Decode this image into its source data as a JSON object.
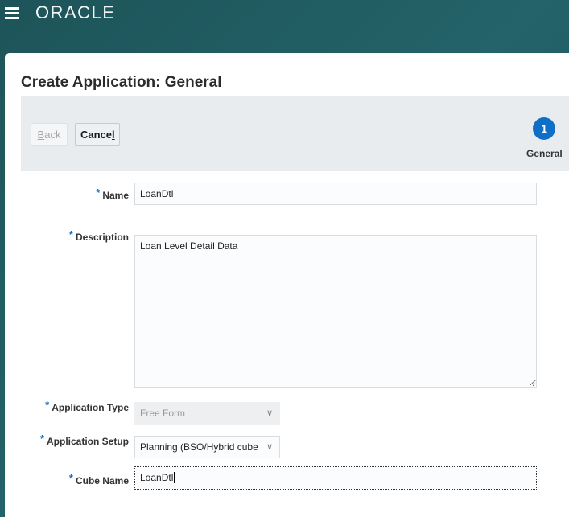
{
  "header": {
    "logo": "ORACLE",
    "menu_icon": "hamburger-icon"
  },
  "page": {
    "title": "Create Application: General"
  },
  "train": {
    "back_pre": "",
    "back_u": "B",
    "back_post": "ack",
    "cancel_pre": "Cance",
    "cancel_u": "l",
    "cancel_post": "",
    "step_number": "1",
    "step_label": "General"
  },
  "form": {
    "name_label": "Name",
    "name_value": "LoanDtl",
    "description_label": "Description",
    "description_value": "Loan Level Detail Data",
    "app_type_label": "Application Type",
    "app_type_value": "Free Form",
    "app_setup_label": "Application Setup",
    "app_setup_value": "Planning (BSO/Hybrid cube",
    "cube_name_label": "Cube Name",
    "cube_name_value": "LoanDtl",
    "required_marker": "*"
  },
  "colors": {
    "accent": "#0f6fc6",
    "background": "#1f5a60"
  }
}
